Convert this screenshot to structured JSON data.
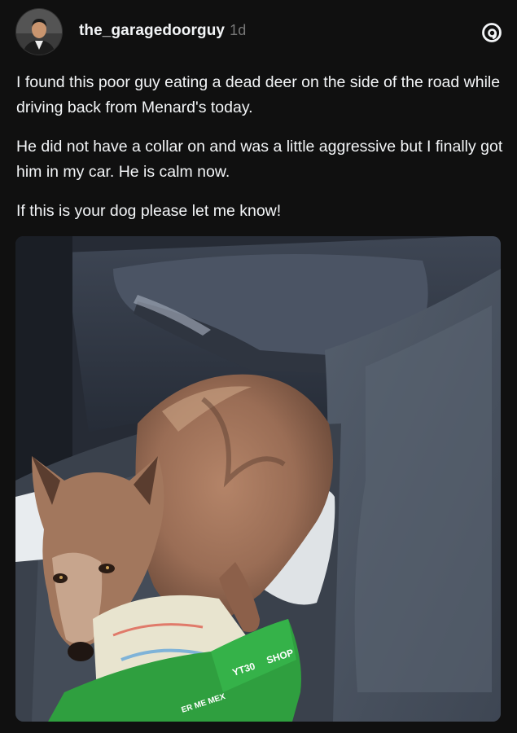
{
  "post": {
    "username": "the_garagedoorguy",
    "time": "1d",
    "paragraphs": [
      "I found this poor guy eating a dead deer on the side of the road while driving back from Menard's today.",
      "He did not have a collar on and was a little aggressive but I finally got him in my car. He is calm now.",
      "If this is your dog please let me know!"
    ],
    "photo_text": {
      "bag_shop": "SHOP",
      "bag_code": "YT30",
      "bag_bottom": "ER ME MEX"
    }
  },
  "icons": {
    "avatar": "profile-photo",
    "app": "threads-icon"
  }
}
